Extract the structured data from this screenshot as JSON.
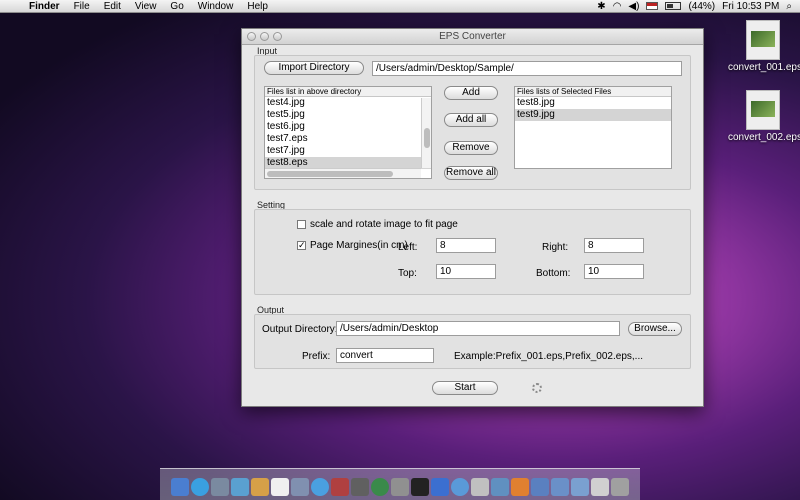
{
  "menubar": {
    "app": "Finder",
    "items": [
      "File",
      "Edit",
      "View",
      "Go",
      "Window",
      "Help"
    ],
    "battery": "(44%)",
    "clock": "Fri 10:53 PM"
  },
  "desktop": {
    "icons": [
      {
        "label": "convert_001.eps"
      },
      {
        "label": "convert_002.eps"
      }
    ]
  },
  "window": {
    "title": "EPS Converter",
    "input": {
      "section_label": "Input",
      "import_button": "Import Directory",
      "directory_path": "/Users/admin/Desktop/Sample/",
      "files_header": "Files list in above directory",
      "files": [
        "test4.jpg",
        "test5.jpg",
        "test6.jpg",
        "test7.eps",
        "test7.jpg",
        "test8.eps"
      ],
      "selected_files_header": "Files lists of Selected Files",
      "selected_files": [
        "test8.jpg",
        "test9.jpg"
      ],
      "add_button": "Add",
      "add_all_button": "Add all",
      "remove_button": "Remove",
      "remove_all_button": "Remove all"
    },
    "setting": {
      "section_label": "Setting",
      "scale_label": "scale and rotate image to fit page",
      "margins_label": "Page Margines(in cm)",
      "left_label": "Left:",
      "left_value": "8",
      "right_label": "Right:",
      "right_value": "8",
      "top_label": "Top:",
      "top_value": "10",
      "bottom_label": "Bottom:",
      "bottom_value": "10"
    },
    "output": {
      "section_label": "Output",
      "directory_label": "Output Directory:",
      "directory_value": "/Users/admin/Desktop",
      "browse_button": "Browse...",
      "prefix_label": "Prefix:",
      "prefix_value": "convert",
      "example_text": "Example:Prefix_001.eps,Prefix_002.eps,..."
    },
    "start_button": "Start"
  }
}
